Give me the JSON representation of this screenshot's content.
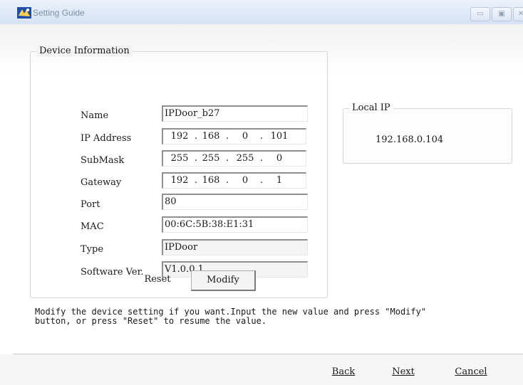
{
  "window": {
    "title": "Setting Guide",
    "min_glyph": "▭",
    "max_glyph": "▣",
    "close_glyph": "✕"
  },
  "device_info": {
    "legend": "Device Information",
    "fields": {
      "name": {
        "label": "Name",
        "value": "IPDoor_b27"
      },
      "ip": {
        "label": "IP Address",
        "octets": [
          "192",
          "168",
          "0",
          "101"
        ]
      },
      "submask": {
        "label": "SubMask",
        "octets": [
          "255",
          "255",
          "255",
          "0"
        ]
      },
      "gateway": {
        "label": "Gateway",
        "octets": [
          "192",
          "168",
          "0",
          "1"
        ]
      },
      "port": {
        "label": "Port",
        "value": "80"
      },
      "mac": {
        "label": "MAC",
        "value": "00:6C:5B:38:E1:31"
      },
      "type": {
        "label": "Type",
        "value": "IPDoor"
      },
      "software": {
        "label": "Software Ver.",
        "value": "V1.0.0.1"
      }
    },
    "reset_label": "Reset",
    "modify_label": "Modify"
  },
  "local_ip": {
    "legend": "Local IP",
    "value": "192.168.0.104"
  },
  "help_text": "Modify the device setting if you want.Input the new value and press \"Modify\"\nbutton, or press \"Reset\" to resume the value.",
  "nav": {
    "back_label": "Back",
    "next_label": "Next",
    "cancel_label": "Cancel"
  },
  "icons": {
    "app": "setting-guide-app-icon"
  },
  "colors": {
    "titlebar": "#d6e2f3",
    "title_text": "#7d8fa8",
    "window_bg": "#f2f2f2"
  }
}
